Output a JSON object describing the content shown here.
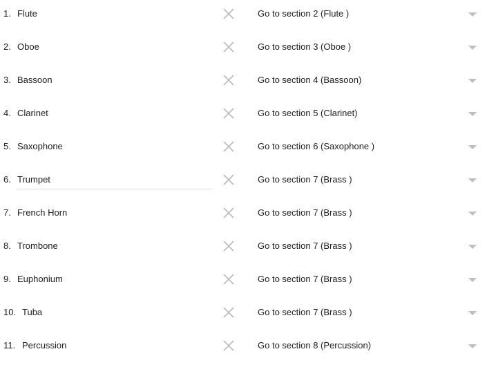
{
  "icons": {
    "remove": "close-icon",
    "dropdown": "arrow-drop-down-icon"
  },
  "colors": {
    "text": "#202124",
    "icon": "#bdbdbd",
    "underline": "#dadce0"
  },
  "options": [
    {
      "number": "1.",
      "label": "Flute",
      "goto": "Go to section 2 (Flute )"
    },
    {
      "number": "2.",
      "label": "Oboe",
      "goto": "Go to section 3 (Oboe )"
    },
    {
      "number": "3.",
      "label": "Bassoon",
      "goto": "Go to section 4 (Bassoon)"
    },
    {
      "number": "4.",
      "label": "Clarinet",
      "goto": "Go to section 5 (Clarinet)"
    },
    {
      "number": "5.",
      "label": "Saxophone",
      "goto": "Go to section 6 (Saxophone )"
    },
    {
      "number": "6.",
      "label": "Trumpet",
      "goto": "Go to section 7 (Brass )",
      "focused": true
    },
    {
      "number": "7.",
      "label": "French Horn",
      "goto": "Go to section 7 (Brass )"
    },
    {
      "number": "8.",
      "label": "Trombone",
      "goto": "Go to section 7 (Brass )"
    },
    {
      "number": "9.",
      "label": "Euphonium",
      "goto": "Go to section 7 (Brass )"
    },
    {
      "number": "10.",
      "label": "Tuba",
      "goto": "Go to section 7 (Brass )"
    },
    {
      "number": "11.",
      "label": "Percussion",
      "goto": "Go to section 8 (Percussion)"
    }
  ]
}
